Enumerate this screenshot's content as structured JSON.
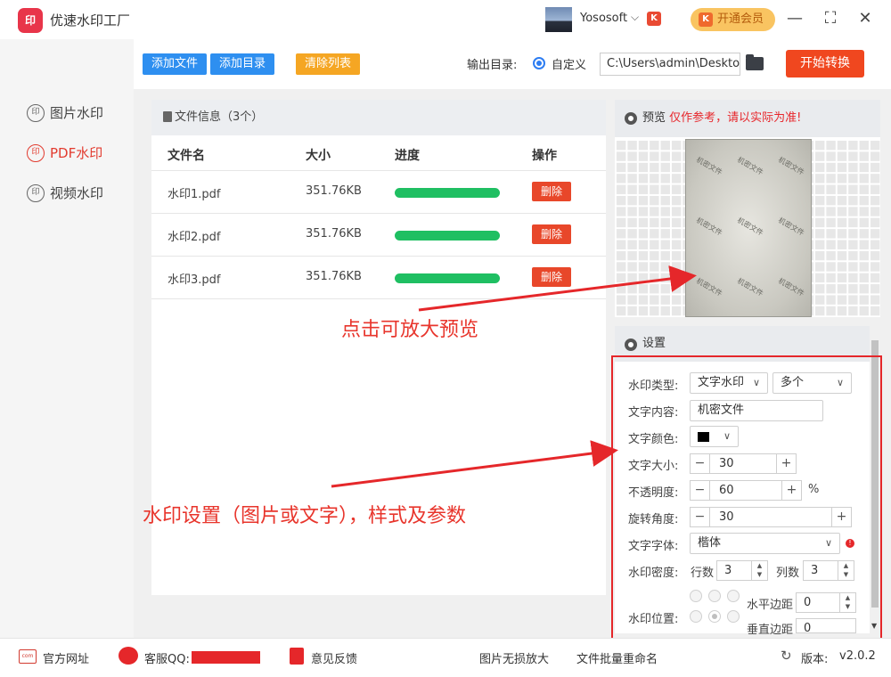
{
  "app": {
    "title": "优速水印工厂",
    "logo_text": "印"
  },
  "user": {
    "name": "Yososoft",
    "vip_label": "开通会员"
  },
  "sidebar": {
    "items": [
      {
        "label": "图片水印",
        "active": false
      },
      {
        "label": "PDF水印",
        "active": true
      },
      {
        "label": "视频水印",
        "active": false
      }
    ]
  },
  "toolbar": {
    "add_file": "添加文件",
    "add_dir": "添加目录",
    "clear_list": "清除列表",
    "output_label": "输出目录:",
    "custom_label": "自定义",
    "output_path": "C:\\Users\\admin\\Desktop",
    "start": "开始转换"
  },
  "files": {
    "header": "文件信息（3个）",
    "columns": [
      "文件名",
      "大小",
      "进度",
      "操作"
    ],
    "rows": [
      {
        "name": "水印1.pdf",
        "size": "351.76KB",
        "progress": 1.0,
        "action": "删除"
      },
      {
        "name": "水印2.pdf",
        "size": "351.76KB",
        "progress": 1.0,
        "action": "删除"
      },
      {
        "name": "水印3.pdf",
        "size": "351.76KB",
        "progress": 1.0,
        "action": "删除"
      }
    ]
  },
  "preview": {
    "label": "预览",
    "warning": "仅作参考，请以实际为准!",
    "watermark_text": "机密文件"
  },
  "settings": {
    "label": "设置",
    "type_label": "水印类型:",
    "type_value": "文字水印",
    "count_value": "多个",
    "content_label": "文字内容:",
    "content_value": "机密文件",
    "color_label": "文字颜色:",
    "color_value": "#000000",
    "size_label": "文字大小:",
    "size_value": "30",
    "opacity_label": "不透明度:",
    "opacity_value": "60",
    "opacity_unit": "%",
    "rotate_label": "旋转角度:",
    "rotate_value": "30",
    "font_label": "文字字体:",
    "font_value": "楷体",
    "density_label": "水印密度:",
    "rows_label": "行数",
    "rows_value": "3",
    "cols_label": "列数",
    "cols_value": "3",
    "position_label": "水印位置:",
    "hmargin_label": "水平边距",
    "hmargin_value": "0",
    "vmargin_label": "垂直边距",
    "vmargin_value": "0"
  },
  "annotations": {
    "preview_tip": "点击可放大预览",
    "settings_tip": "水印设置（图片或文字），样式及参数"
  },
  "footer": {
    "website": "官方网址",
    "qq": "客服QQ:",
    "feedback": "意见反馈",
    "lossless": "图片无损放大",
    "rename": "文件批量重命名",
    "version_label": "版本:",
    "version": "v2.0.2"
  },
  "colors": {
    "accent": "#e23b2f",
    "progress": "#1fbf62",
    "annotation": "#e5272a"
  }
}
